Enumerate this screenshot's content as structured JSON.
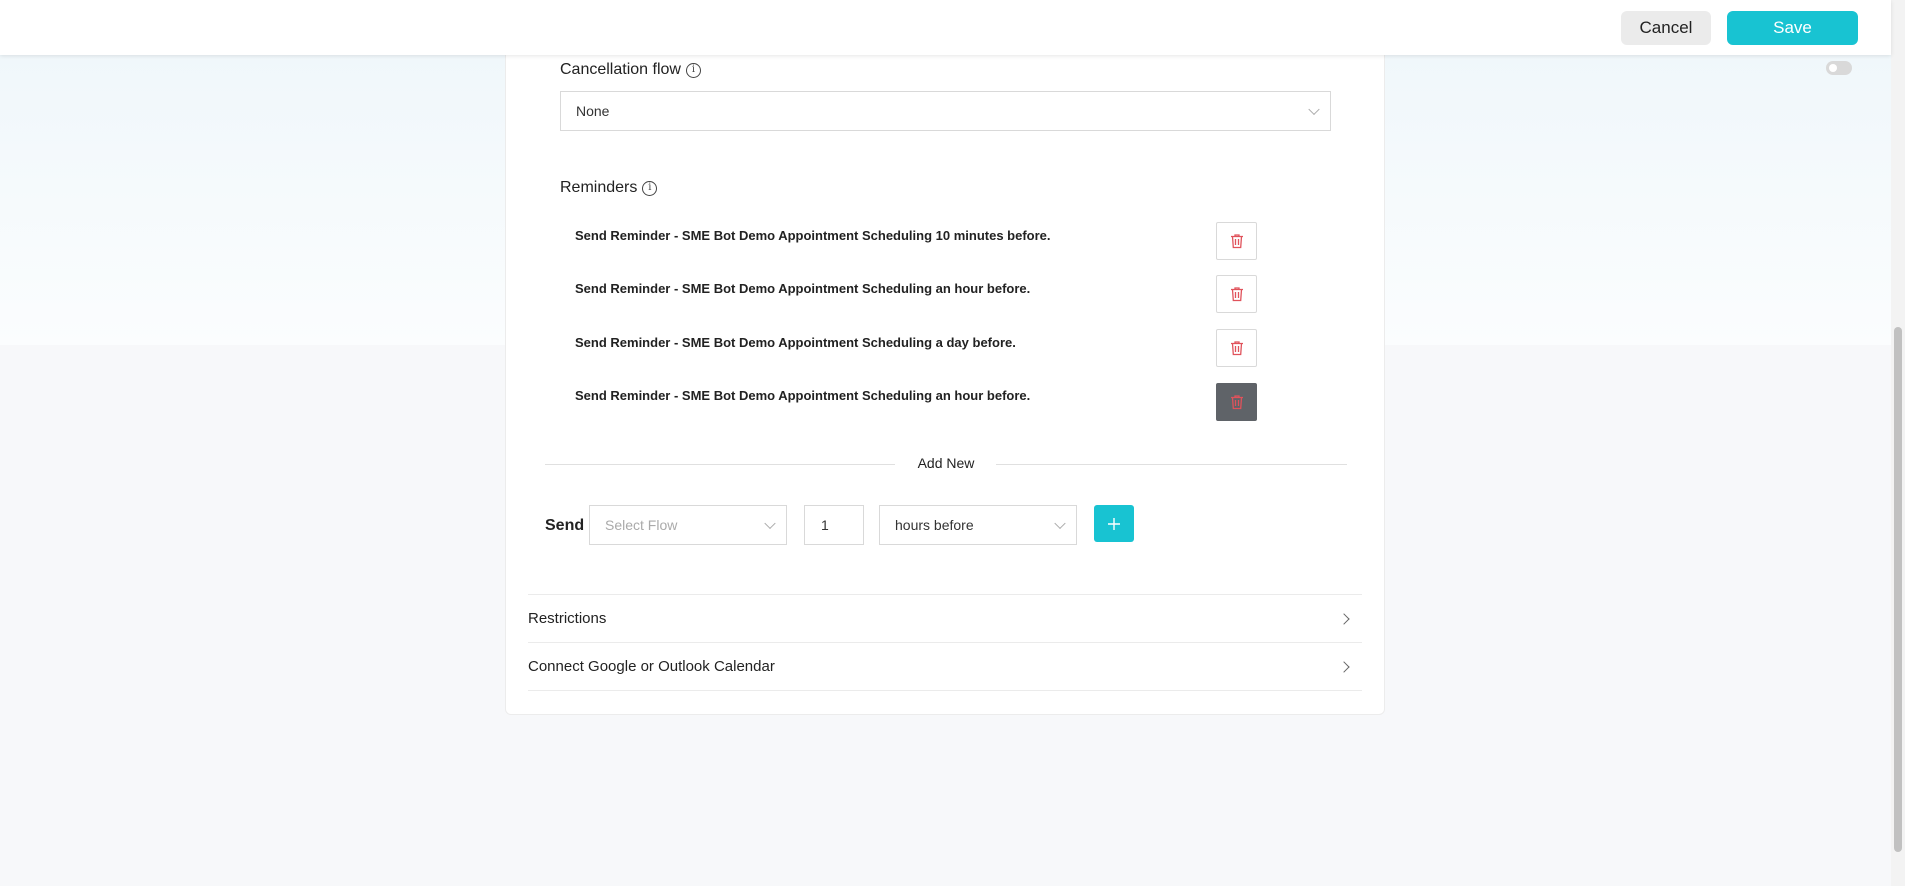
{
  "header": {
    "cancel_label": "Cancel",
    "save_label": "Save"
  },
  "form": {
    "cancellation_flow": {
      "label": "Cancellation flow",
      "value": "None"
    },
    "reminders": {
      "label": "Reminders",
      "items": [
        "Send Reminder - SME Bot Demo Appointment Scheduling 10 minutes before.",
        "Send Reminder - SME Bot Demo Appointment Scheduling an hour before.",
        "Send Reminder - SME Bot Demo Appointment Scheduling a day before.",
        "Send Reminder - SME Bot Demo Appointment Scheduling an hour before."
      ]
    },
    "add_new": {
      "label": "Add New",
      "send_label": "Send",
      "flow_placeholder": "Select Flow",
      "amount_value": "1",
      "unit_value": "hours before"
    },
    "sections": [
      "Restrictions",
      "Connect Google or Outlook Calendar"
    ]
  },
  "icons": {
    "trash": "trash-icon",
    "info": "info-icon",
    "plus": "plus-icon",
    "chevron_down": "chevron-down-icon",
    "chevron_right": "chevron-right-icon"
  },
  "colors": {
    "accent": "#18c3d2",
    "danger": "#e0525b",
    "cancel_bg": "#ebebeb"
  }
}
